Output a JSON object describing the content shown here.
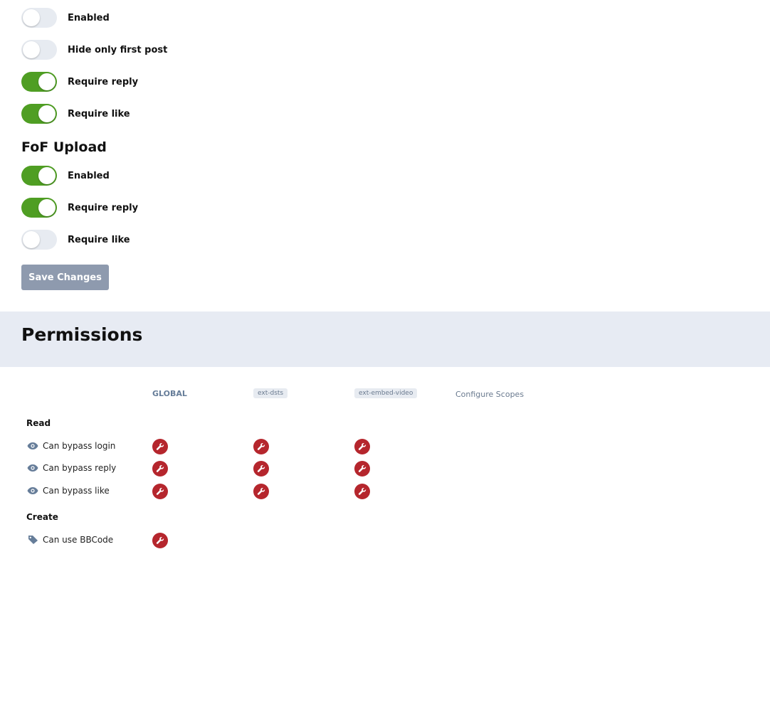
{
  "settings": {
    "toggles_top": [
      {
        "label": "Enabled",
        "on": false
      },
      {
        "label": "Hide only first post",
        "on": false
      },
      {
        "label": "Require reply",
        "on": true
      },
      {
        "label": "Require like",
        "on": true
      }
    ],
    "upload_section_title": "FoF Upload",
    "toggles_upload": [
      {
        "label": "Enabled",
        "on": true
      },
      {
        "label": "Require reply",
        "on": true
      },
      {
        "label": "Require like",
        "on": false
      }
    ],
    "save_label": "Save Changes"
  },
  "colors": {
    "toggle_on": "#4f9e23",
    "toggle_off": "#e7ebf1",
    "permission_denied": "#b5262d",
    "header_bg": "#e7ebf3"
  },
  "permissions": {
    "title": "Permissions",
    "columns": {
      "global": "GLOBAL",
      "scope1": "ext-dsts",
      "scope2": "ext-embed-video",
      "configure": "Configure Scopes"
    },
    "groups": [
      {
        "title": "Read",
        "items": [
          {
            "label": "Can bypass login",
            "icon": "eye-icon"
          },
          {
            "label": "Can bypass reply",
            "icon": "eye-icon"
          },
          {
            "label": "Can bypass like",
            "icon": "eye-icon"
          }
        ]
      },
      {
        "title": "Create",
        "items": [
          {
            "label": "Can use BBCode",
            "icon": "tag-icon"
          }
        ]
      }
    ]
  }
}
